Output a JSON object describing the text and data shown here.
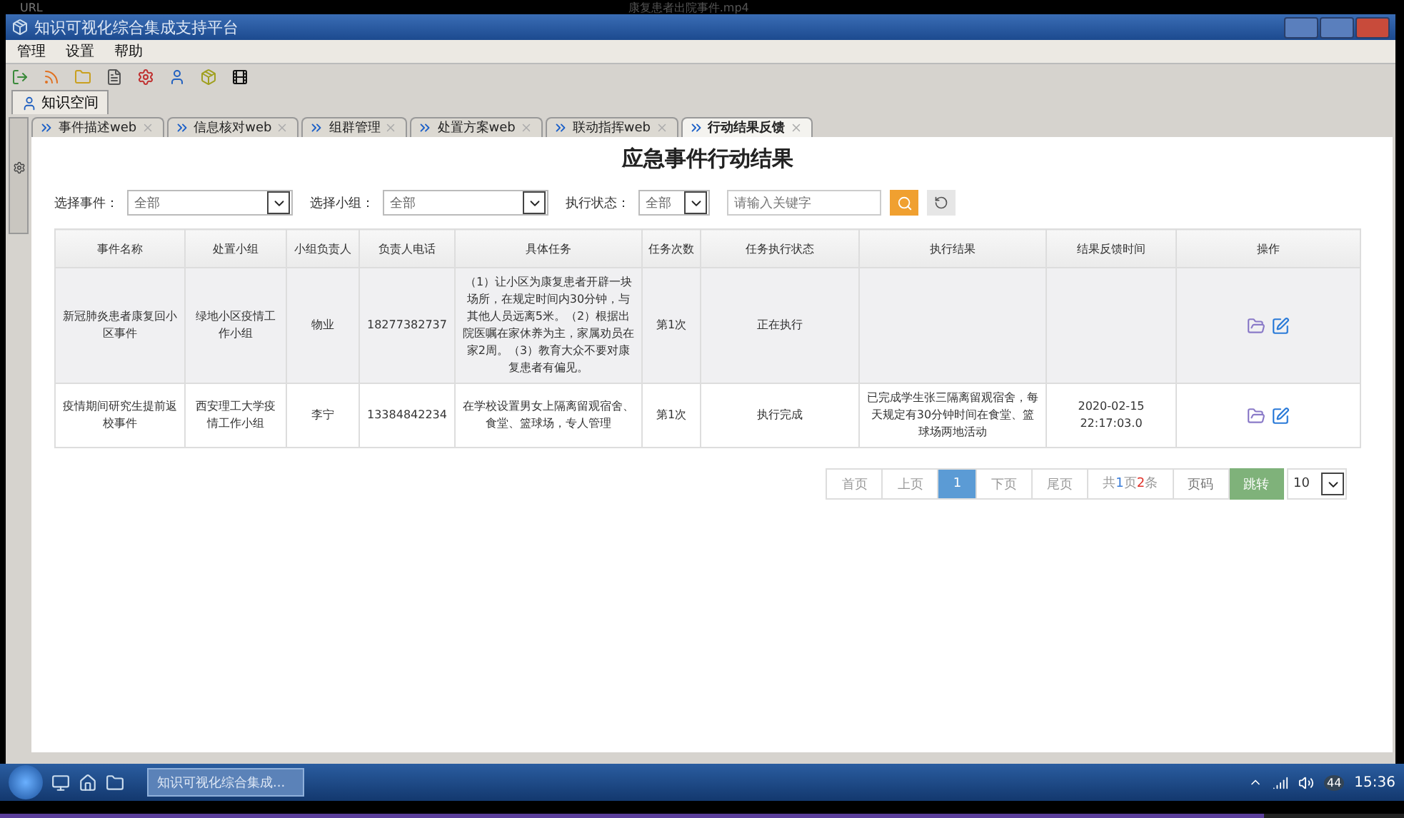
{
  "recorder_bar": {
    "label": "URL",
    "file_name": "康复患者出院事件.mp4"
  },
  "window": {
    "title": "知识可视化综合集成支持平台"
  },
  "menu": [
    "管理",
    "设置",
    "帮助"
  ],
  "space_tab": {
    "label": "知识空间"
  },
  "doc_tabs": [
    {
      "label": "事件描述web",
      "selected": false
    },
    {
      "label": "信息核对web",
      "selected": false
    },
    {
      "label": "组群管理",
      "selected": false
    },
    {
      "label": "处置方案web",
      "selected": false
    },
    {
      "label": "联动指挥web",
      "selected": false
    },
    {
      "label": "行动结果反馈",
      "selected": true
    }
  ],
  "page_title": "应急事件行动结果",
  "filters": {
    "event_label": "选择事件：",
    "event_value": "全部",
    "group_label": "选择小组：",
    "group_value": "全部",
    "status_label": "执行状态：",
    "status_value": "全部",
    "search_placeholder": "请输入关键字"
  },
  "table": {
    "columns": [
      "事件名称",
      "处置小组",
      "小组负责人",
      "负责人电话",
      "具体任务",
      "任务次数",
      "任务执行状态",
      "执行结果",
      "结果反馈时间",
      "操作"
    ],
    "rows": [
      {
        "selected": true,
        "cells": [
          "新冠肺炎患者康复回小区事件",
          "绿地小区疫情工作小组",
          "物业",
          "18277382737",
          "（1）让小区为康复患者开辟一块场所，在规定时间内30分钟，与其他人员远离5米。（2）根据出院医嘱在家休养为主，家属劝员在家2周。（3）教育大众不要对康复患者有偏见。",
          "第1次",
          "正在执行",
          "",
          ""
        ]
      },
      {
        "selected": false,
        "cells": [
          "疫情期间研究生提前返校事件",
          "西安理工大学疫情工作小组",
          "李宁",
          "13384842234",
          "在学校设置男女上隔离留观宿舍、食堂、篮球场，专人管理",
          "第1次",
          "执行完成",
          "已完成学生张三隔离留观宿舍，每天规定有30分钟时间在食堂、篮球场两地活动",
          "2020-02-15 22:17:03.0"
        ]
      }
    ]
  },
  "pagination": {
    "buttons": [
      {
        "label": "首页",
        "selected": false
      },
      {
        "label": "上页",
        "selected": false
      },
      {
        "label": "1",
        "selected": true
      },
      {
        "label": "下页",
        "selected": false
      },
      {
        "label": "尾页",
        "selected": false
      }
    ],
    "total": "共**1**页**2**条",
    "page_input_placeholder": "页码",
    "go": "跳转",
    "page_size": "10"
  },
  "video_progress": {
    "level": 0.9
  },
  "taskbar": {
    "task": "知识可视化综合集成...",
    "clock": "15:36",
    "badge": "44"
  }
}
